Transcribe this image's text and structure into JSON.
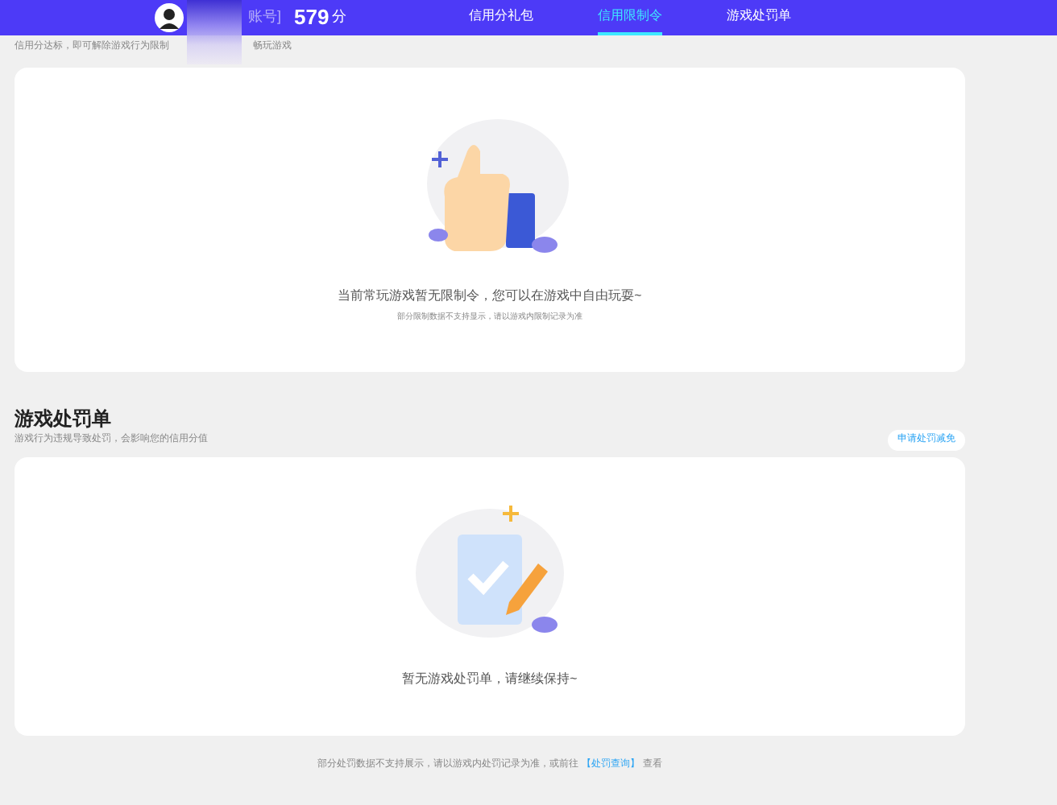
{
  "header": {
    "account_tag": "账号]",
    "score": "579",
    "score_unit": "分",
    "nav": [
      {
        "label": "信用分礼包",
        "selected": false
      },
      {
        "label": "信用限制令",
        "selected": true
      },
      {
        "label": "游戏处罚单",
        "selected": false
      }
    ]
  },
  "restriction": {
    "intro": "信用分达标，即可解除游戏行为限制",
    "intro_tail": "畅玩游戏",
    "message": "当前常玩游戏暂无限制令，您可以在游戏中自由玩耍~",
    "note": "部分限制数据不支持显示，请以游戏内限制记录为准"
  },
  "penalty": {
    "title": "游戏处罚单",
    "subtitle": "游戏行为违规导致处罚，会影响您的信用分值",
    "action": "申请处罚减免",
    "message": "暂无游戏处罚单，请继续保持~"
  },
  "footer": {
    "text": "部分处罚数据不支持展示，请以游戏内处罚记录为准，或前往",
    "link": "【处罚查询】",
    "tail": "查看"
  }
}
